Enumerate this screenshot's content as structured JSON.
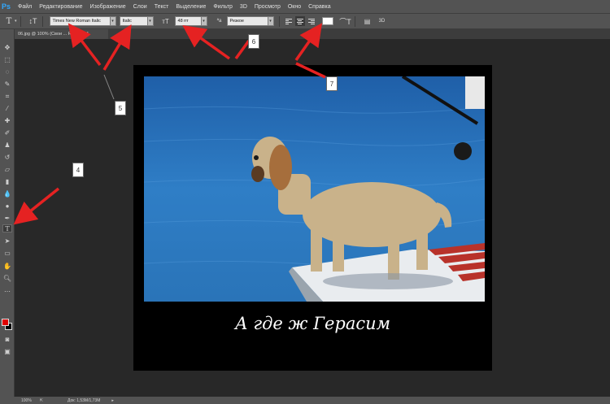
{
  "app": {
    "logo": "Ps"
  },
  "menu": [
    "Файл",
    "Редактирование",
    "Изображение",
    "Слои",
    "Текст",
    "Выделение",
    "Фильтр",
    "3D",
    "Просмотр",
    "Окно",
    "Справка"
  ],
  "options": {
    "font_family": "Times New Roman Italic",
    "font_style": "Italic",
    "font_size": "48 пт",
    "antialias": "Резкое",
    "text_color": "#ffffff",
    "three_d": "3D"
  },
  "document": {
    "tab_title": "06.jpg @ 100% (Свои ... RGB/8#) *",
    "caption": "А где ж Герасим"
  },
  "status": {
    "zoom": "100%",
    "doc_size": "Док: 1,53M/1,73M"
  },
  "annotations": [
    "4",
    "5",
    "6",
    "7"
  ],
  "colors": {
    "foreground": "#e00000",
    "background": "#000000",
    "arrow": "#e52222"
  }
}
